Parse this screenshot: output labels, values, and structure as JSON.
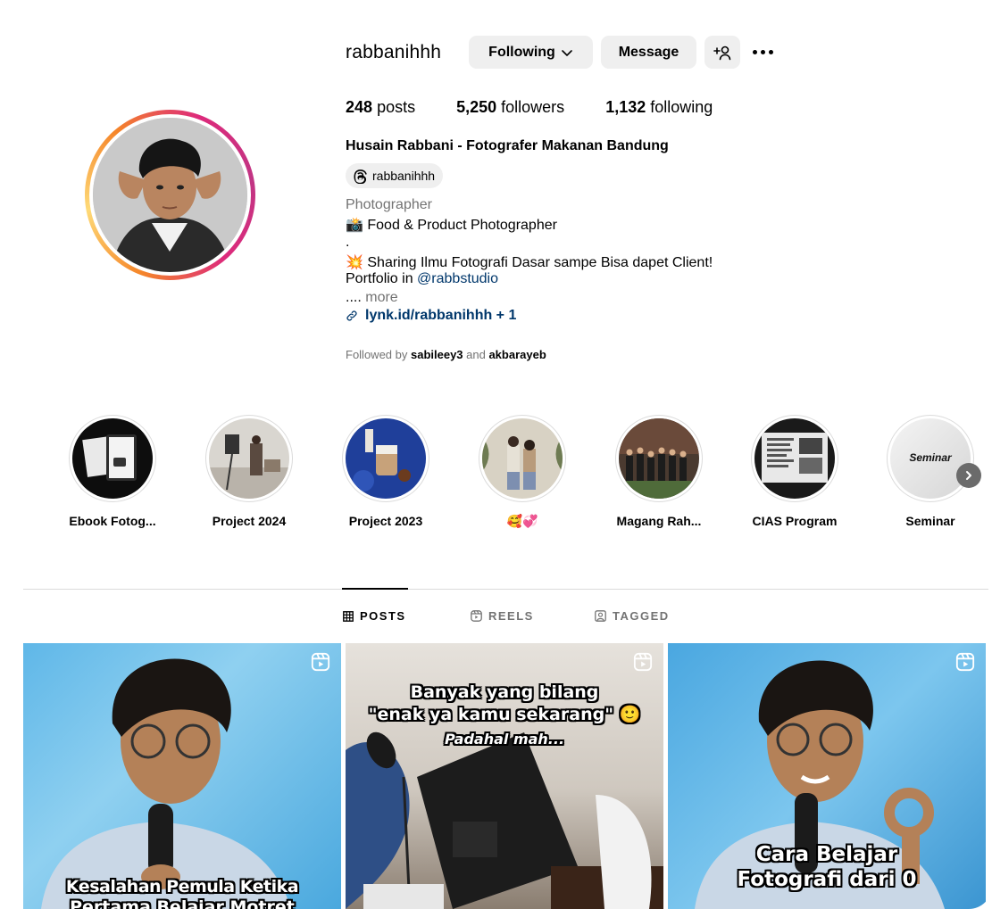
{
  "profile": {
    "username": "rabbanihhh",
    "following_button": "Following",
    "message_button": "Message",
    "stats": {
      "posts_count": "248",
      "posts_label": "posts",
      "followers_count": "5,250",
      "followers_label": "followers",
      "following_count": "1,132",
      "following_label": "following"
    },
    "full_name": "Husain Rabbani - Fotografer Makanan Bandung",
    "threads_handle": "rabbanihhh",
    "category": "Photographer",
    "bio": {
      "line1": "📸 Food & Product Photographer",
      "line2": ".",
      "line3": "💥 Sharing Ilmu Fotografi Dasar sampe Bisa dapet Client!",
      "line4_prefix": "Portfolio in ",
      "line4_mention": "@rabbstudio",
      "line5_prefix": ".... ",
      "line5_more": "more"
    },
    "link": "lynk.id/rabbanihhh + 1",
    "followed_by": {
      "prefix": "Followed by ",
      "user1": "sabileey3",
      "joiner": " and ",
      "user2": "akbarayeb"
    }
  },
  "highlights": [
    {
      "label": "Ebook Fotog..."
    },
    {
      "label": "Project 2024"
    },
    {
      "label": "Project 2023"
    },
    {
      "label": "🥰💞"
    },
    {
      "label": "Magang Rah..."
    },
    {
      "label": "CIAS Program"
    },
    {
      "label": "Seminar",
      "cover_text": "Seminar"
    }
  ],
  "tabs": [
    {
      "label": "POSTS",
      "active": true
    },
    {
      "label": "REELS",
      "active": false
    },
    {
      "label": "TAGGED",
      "active": false
    }
  ],
  "posts": [
    {
      "caption_line1": "Kesalahan Pemula Ketika",
      "caption_line2": "Pertama Belajar Motret"
    },
    {
      "caption_line1": "Banyak yang bilang",
      "caption_line2": "\"enak ya kamu sekarang\" 🙂",
      "caption_line3": "Padahal mah..."
    },
    {
      "caption_line1": "Cara Belajar",
      "caption_line2": "Fotografi dari 0"
    }
  ],
  "colors": {
    "button_bg": "#efefef",
    "link_blue": "#00376b",
    "muted_text": "#737373",
    "divider": "#dbdbdb"
  },
  "icons": {
    "following_chevron": "chevron-down-icon",
    "add_user": "add-user-icon",
    "more": "more-dots-icon",
    "threads": "threads-icon",
    "link": "link-icon",
    "posts_tab": "grid-icon",
    "reels_tab": "reels-icon",
    "tagged_tab": "tagged-icon",
    "reel_badge": "reel-badge-icon",
    "next": "chevron-right-icon"
  }
}
